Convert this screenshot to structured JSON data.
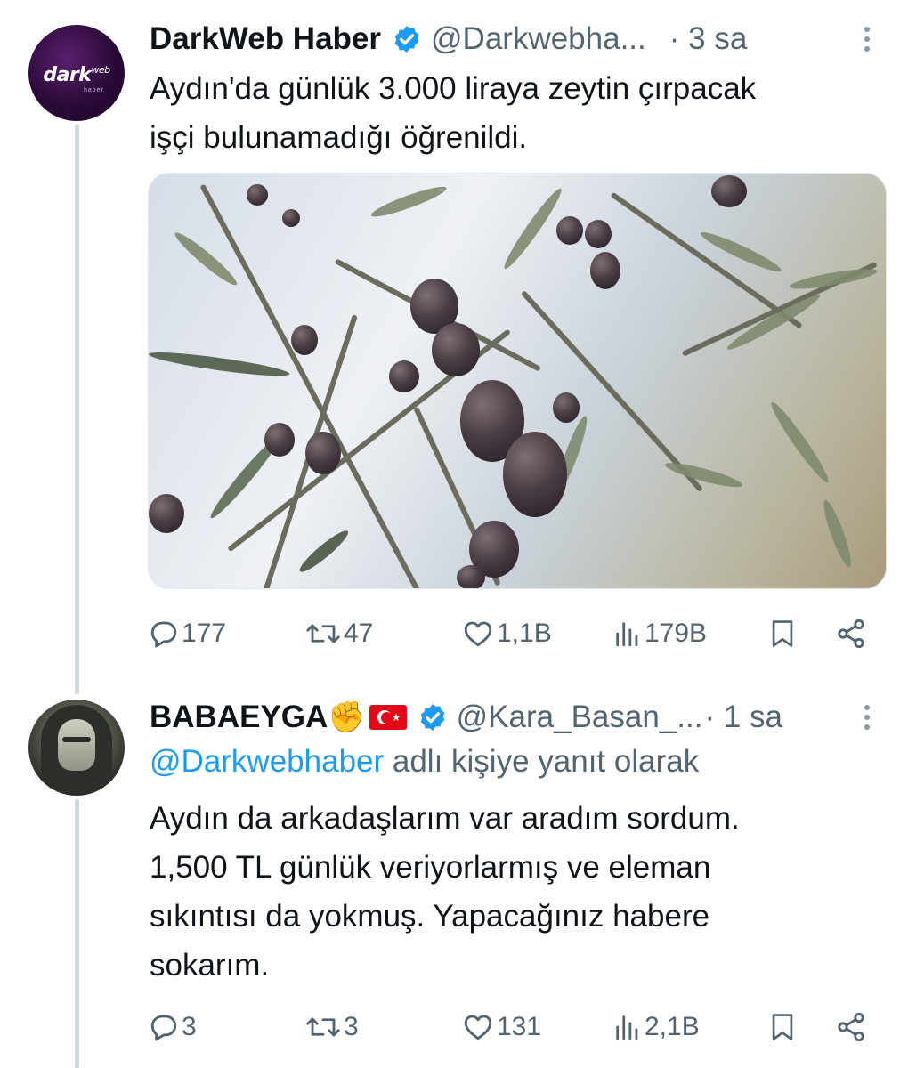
{
  "tweets": [
    {
      "author_name": "DarkWeb Haber",
      "handle": "@Darkwebha...",
      "time": "· 3 sa",
      "text_lines": [
        "Aydın'da günlük 3.000 liraya zeytin çırpacak",
        "işçi bulunamadığı öğrenildi."
      ],
      "avatar_logo": "dark",
      "avatar_logo_small": "web",
      "avatar_sub": "haber",
      "stats": {
        "replies": "177",
        "retweets": "47",
        "likes": "1,1B",
        "views": "179B"
      }
    },
    {
      "author_name": "BABAEYGA",
      "handle": "@Kara_Basan_...",
      "time": "· 1 sa",
      "reply_mention": "@Darkwebhaber",
      "reply_suffix": " adlı kişiye yanıt olarak",
      "text_lines": [
        "Aydın da arkadaşlarım var aradım sordum.",
        "1,500 TL günlük veriyorlarmış ve eleman",
        "sıkıntısı da yokmuş. Yapacağınız habere",
        "sokarım."
      ],
      "name_emoji": "✊",
      "stats": {
        "replies": "3",
        "retweets": "3",
        "likes": "131",
        "views": "2,1B"
      }
    }
  ],
  "icons": [
    "verified-badge-icon",
    "more-options-icon",
    "reply-icon",
    "retweet-icon",
    "like-icon",
    "views-icon",
    "bookmark-icon",
    "share-icon"
  ],
  "colors": {
    "accent": "#1d9bf0",
    "secondary_text": "#536471",
    "thread_line": "#cfd9de"
  }
}
